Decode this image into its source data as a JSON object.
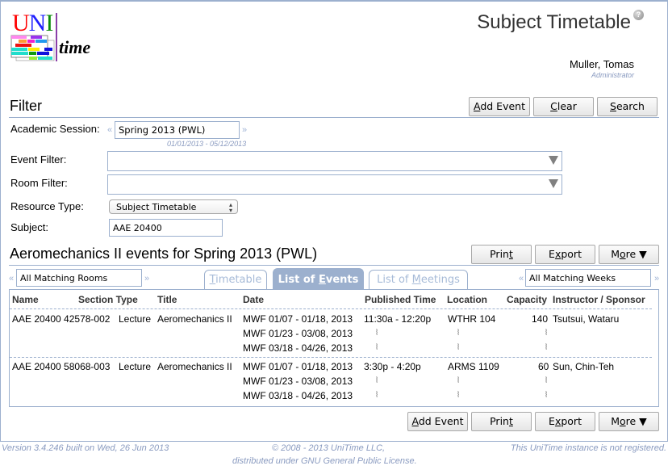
{
  "header": {
    "logo_text": {
      "u": "U",
      "n": "N",
      "i": "I",
      "time": "time"
    },
    "title": "Subject Timetable",
    "help_icon": "?",
    "user_name": "Muller, Tomas",
    "user_role": "Administrator"
  },
  "filter": {
    "title": "Filter",
    "buttons": {
      "add_event": "Add Event",
      "clear": "Clear",
      "search": "Search"
    },
    "academic_session": {
      "label": "Academic Session:",
      "value": "Spring 2013 (PWL)",
      "date_range": "01/01/2013 - 05/12/2013",
      "prev": "«",
      "next": "»"
    },
    "event_filter": {
      "label": "Event Filter:",
      "value": ""
    },
    "room_filter": {
      "label": "Room Filter:",
      "value": ""
    },
    "resource_type": {
      "label": "Resource Type:",
      "value": "Subject Timetable"
    },
    "subject": {
      "label": "Subject:",
      "value": "AAE 20400"
    }
  },
  "results": {
    "title": "Aeromechanics II events for Spring 2013 (PWL)",
    "buttons": {
      "print": "Print",
      "export": "Export",
      "more": "More ▼",
      "add_event": "Add Event"
    },
    "rooms_selector": {
      "value": "All Matching Rooms",
      "prev": "«",
      "next": "»"
    },
    "weeks_selector": {
      "value": "All Matching Weeks",
      "prev": "«",
      "next": "»"
    },
    "tabs": [
      {
        "label": "Timetable",
        "active": false
      },
      {
        "label": "List of Events",
        "active": true
      },
      {
        "label": "List of Meetings",
        "active": false
      }
    ],
    "columns": [
      "Name",
      "Section Type",
      "Title",
      "Date",
      "Published Time",
      "Location",
      "Capacity",
      "Instructor / Sponsor"
    ],
    "rows": [
      {
        "name": "AAE 20400 42578-002",
        "section_type": "Lecture",
        "title": "Aeromechanics II",
        "dates": [
          "MWF 01/07 - 01/18, 2013",
          "MWF 01/23 - 03/08, 2013",
          "MWF 03/18 - 04/26, 2013"
        ],
        "time": "11:30a - 12:20p",
        "location": "WTHR 104",
        "capacity": "140",
        "instructor": "Tsutsui, Wataru"
      },
      {
        "name": "AAE 20400 58068-003",
        "section_type": "Lecture",
        "title": "Aeromechanics II",
        "dates": [
          "MWF 01/07 - 01/18, 2013",
          "MWF 01/23 - 03/08, 2013",
          "MWF 03/18 - 04/26, 2013"
        ],
        "time": "3:30p - 4:20p",
        "location": "ARMS 1109",
        "capacity": "60",
        "instructor": "Sun, Chin-Teh"
      }
    ],
    "continuation_mark": "⦚"
  },
  "footer": {
    "version": "Version 3.4.246 built on Wed, 26 Jun 2013",
    "copyright_line1": "© 2008 - 2013 UniTime LLC,",
    "copyright_line2": "distributed under GNU General Public License.",
    "registration": "This UniTime instance is not registered."
  }
}
